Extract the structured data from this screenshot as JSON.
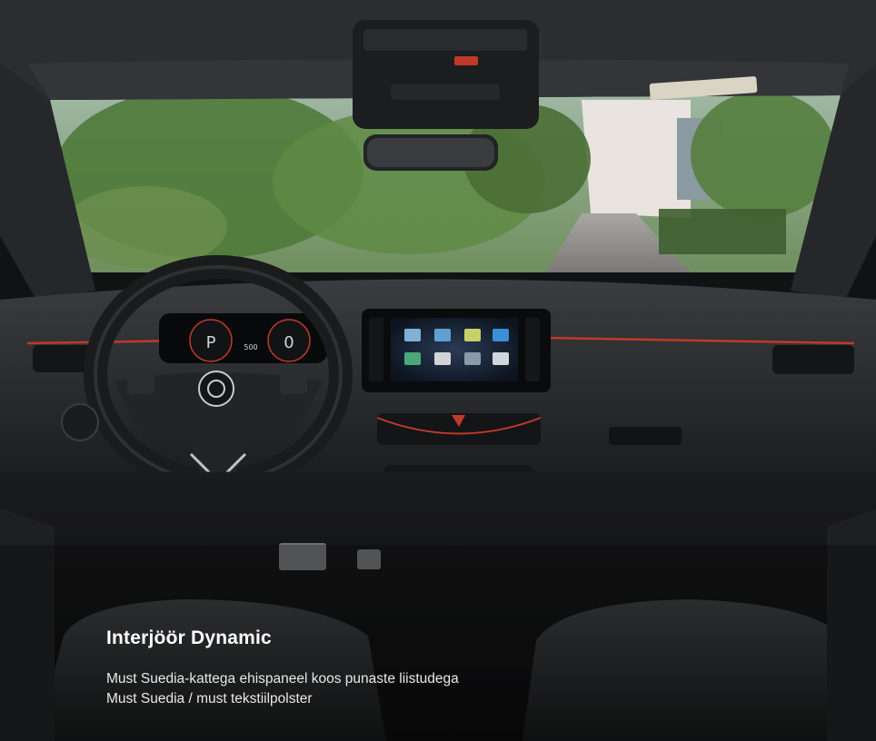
{
  "photo": {
    "subject": "car-interior",
    "colors": {
      "accent": "#c0392b",
      "dashboard": "#2a2c2f",
      "seat": "#2b2c2e",
      "sky": "#e9e4df",
      "foliage": "#4f7a3a"
    },
    "instrument_cluster": {
      "left_gauge": "P",
      "center_readout": "500",
      "right_gauge": "0"
    }
  },
  "caption": {
    "title": "Interjöör Dynamic",
    "lines": [
      "Must Suedia-kattega ehispaneel koos punaste liistudega",
      "Must Suedia / must tekstiilpolster"
    ]
  }
}
